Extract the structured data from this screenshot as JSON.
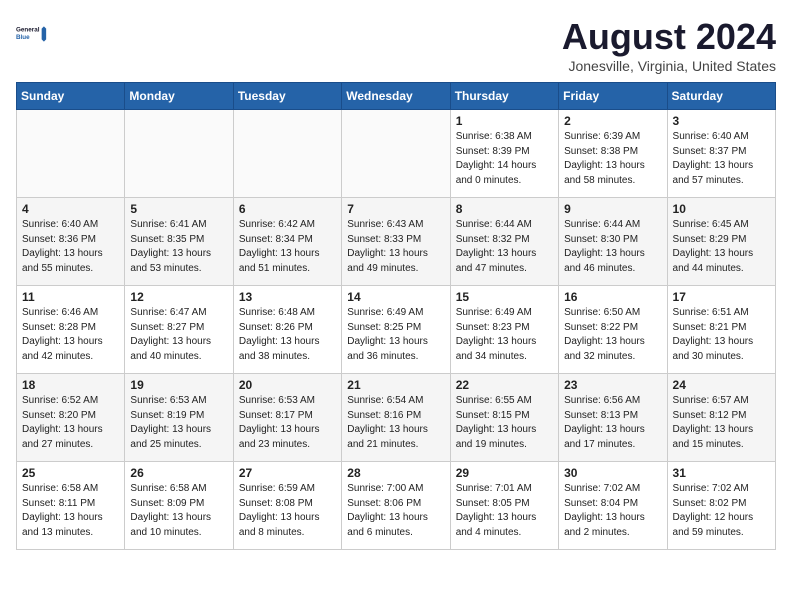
{
  "header": {
    "logo_line1": "General",
    "logo_line2": "Blue",
    "title": "August 2024",
    "subtitle": "Jonesville, Virginia, United States"
  },
  "days_of_week": [
    "Sunday",
    "Monday",
    "Tuesday",
    "Wednesday",
    "Thursday",
    "Friday",
    "Saturday"
  ],
  "weeks": [
    [
      {
        "day": "",
        "info": ""
      },
      {
        "day": "",
        "info": ""
      },
      {
        "day": "",
        "info": ""
      },
      {
        "day": "",
        "info": ""
      },
      {
        "day": "1",
        "info": "Sunrise: 6:38 AM\nSunset: 8:39 PM\nDaylight: 14 hours\nand 0 minutes."
      },
      {
        "day": "2",
        "info": "Sunrise: 6:39 AM\nSunset: 8:38 PM\nDaylight: 13 hours\nand 58 minutes."
      },
      {
        "day": "3",
        "info": "Sunrise: 6:40 AM\nSunset: 8:37 PM\nDaylight: 13 hours\nand 57 minutes."
      }
    ],
    [
      {
        "day": "4",
        "info": "Sunrise: 6:40 AM\nSunset: 8:36 PM\nDaylight: 13 hours\nand 55 minutes."
      },
      {
        "day": "5",
        "info": "Sunrise: 6:41 AM\nSunset: 8:35 PM\nDaylight: 13 hours\nand 53 minutes."
      },
      {
        "day": "6",
        "info": "Sunrise: 6:42 AM\nSunset: 8:34 PM\nDaylight: 13 hours\nand 51 minutes."
      },
      {
        "day": "7",
        "info": "Sunrise: 6:43 AM\nSunset: 8:33 PM\nDaylight: 13 hours\nand 49 minutes."
      },
      {
        "day": "8",
        "info": "Sunrise: 6:44 AM\nSunset: 8:32 PM\nDaylight: 13 hours\nand 47 minutes."
      },
      {
        "day": "9",
        "info": "Sunrise: 6:44 AM\nSunset: 8:30 PM\nDaylight: 13 hours\nand 46 minutes."
      },
      {
        "day": "10",
        "info": "Sunrise: 6:45 AM\nSunset: 8:29 PM\nDaylight: 13 hours\nand 44 minutes."
      }
    ],
    [
      {
        "day": "11",
        "info": "Sunrise: 6:46 AM\nSunset: 8:28 PM\nDaylight: 13 hours\nand 42 minutes."
      },
      {
        "day": "12",
        "info": "Sunrise: 6:47 AM\nSunset: 8:27 PM\nDaylight: 13 hours\nand 40 minutes."
      },
      {
        "day": "13",
        "info": "Sunrise: 6:48 AM\nSunset: 8:26 PM\nDaylight: 13 hours\nand 38 minutes."
      },
      {
        "day": "14",
        "info": "Sunrise: 6:49 AM\nSunset: 8:25 PM\nDaylight: 13 hours\nand 36 minutes."
      },
      {
        "day": "15",
        "info": "Sunrise: 6:49 AM\nSunset: 8:23 PM\nDaylight: 13 hours\nand 34 minutes."
      },
      {
        "day": "16",
        "info": "Sunrise: 6:50 AM\nSunset: 8:22 PM\nDaylight: 13 hours\nand 32 minutes."
      },
      {
        "day": "17",
        "info": "Sunrise: 6:51 AM\nSunset: 8:21 PM\nDaylight: 13 hours\nand 30 minutes."
      }
    ],
    [
      {
        "day": "18",
        "info": "Sunrise: 6:52 AM\nSunset: 8:20 PM\nDaylight: 13 hours\nand 27 minutes."
      },
      {
        "day": "19",
        "info": "Sunrise: 6:53 AM\nSunset: 8:19 PM\nDaylight: 13 hours\nand 25 minutes."
      },
      {
        "day": "20",
        "info": "Sunrise: 6:53 AM\nSunset: 8:17 PM\nDaylight: 13 hours\nand 23 minutes."
      },
      {
        "day": "21",
        "info": "Sunrise: 6:54 AM\nSunset: 8:16 PM\nDaylight: 13 hours\nand 21 minutes."
      },
      {
        "day": "22",
        "info": "Sunrise: 6:55 AM\nSunset: 8:15 PM\nDaylight: 13 hours\nand 19 minutes."
      },
      {
        "day": "23",
        "info": "Sunrise: 6:56 AM\nSunset: 8:13 PM\nDaylight: 13 hours\nand 17 minutes."
      },
      {
        "day": "24",
        "info": "Sunrise: 6:57 AM\nSunset: 8:12 PM\nDaylight: 13 hours\nand 15 minutes."
      }
    ],
    [
      {
        "day": "25",
        "info": "Sunrise: 6:58 AM\nSunset: 8:11 PM\nDaylight: 13 hours\nand 13 minutes."
      },
      {
        "day": "26",
        "info": "Sunrise: 6:58 AM\nSunset: 8:09 PM\nDaylight: 13 hours\nand 10 minutes."
      },
      {
        "day": "27",
        "info": "Sunrise: 6:59 AM\nSunset: 8:08 PM\nDaylight: 13 hours\nand 8 minutes."
      },
      {
        "day": "28",
        "info": "Sunrise: 7:00 AM\nSunset: 8:06 PM\nDaylight: 13 hours\nand 6 minutes."
      },
      {
        "day": "29",
        "info": "Sunrise: 7:01 AM\nSunset: 8:05 PM\nDaylight: 13 hours\nand 4 minutes."
      },
      {
        "day": "30",
        "info": "Sunrise: 7:02 AM\nSunset: 8:04 PM\nDaylight: 13 hours\nand 2 minutes."
      },
      {
        "day": "31",
        "info": "Sunrise: 7:02 AM\nSunset: 8:02 PM\nDaylight: 12 hours\nand 59 minutes."
      }
    ]
  ]
}
